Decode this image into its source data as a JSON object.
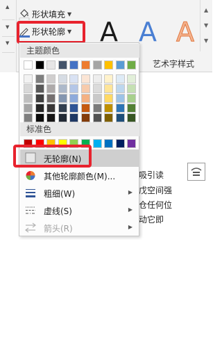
{
  "ribbon": {
    "shape_fill_label": "形状填充",
    "shape_outline_label": "形状轮廓",
    "wordart_letter": "A",
    "wordart_styles_label": "艺术字样式",
    "wordart_colors": [
      "#1a1a1a",
      "#4a7fd3",
      "#f0a070"
    ]
  },
  "menu": {
    "theme_colors_header": "主题颜色",
    "standard_colors_header": "标准色",
    "theme_colors_top": [
      "#ffffff",
      "#000000",
      "#e7e6e6",
      "#44546a",
      "#4472c4",
      "#ed7d31",
      "#a5a5a5",
      "#ffc000",
      "#5b9bd5",
      "#70ad47"
    ],
    "theme_colors_shades": [
      [
        "#f2f2f2",
        "#7f7f7f",
        "#d0cece",
        "#d6dce4",
        "#d9e2f3",
        "#fbe5d5",
        "#ededed",
        "#fff2cc",
        "#deebf6",
        "#e2efd9"
      ],
      [
        "#d8d8d8",
        "#595959",
        "#aeaaaa",
        "#adb9ca",
        "#b4c6e7",
        "#f7cbac",
        "#dbdbdb",
        "#fee599",
        "#bdd7ee",
        "#c5e0b3"
      ],
      [
        "#bfbfbf",
        "#3f3f3f",
        "#757070",
        "#8496b0",
        "#8eaadb",
        "#f4b183",
        "#c9c9c9",
        "#ffd965",
        "#9dc3e6",
        "#a8d08d"
      ],
      [
        "#a5a5a5",
        "#262626",
        "#3a3838",
        "#323f4f",
        "#2f5496",
        "#c55a11",
        "#7b7b7b",
        "#bf9000",
        "#2e75b5",
        "#538135"
      ],
      [
        "#7f7f7f",
        "#0c0c0c",
        "#171616",
        "#222a35",
        "#1f3864",
        "#833c0b",
        "#525252",
        "#7f6000",
        "#1e4e79",
        "#375623"
      ]
    ],
    "standard_colors": [
      "#c00000",
      "#ff0000",
      "#ffc000",
      "#ffff00",
      "#92d050",
      "#00b050",
      "#00b0f0",
      "#0070c0",
      "#002060",
      "#7030a0"
    ],
    "no_outline_label": "无轮廓(N)",
    "more_colors_label": "其他轮廓颜色(M)...",
    "weight_label": "粗细(W)",
    "dashes_label": "虚线(S)",
    "arrows_label": "箭头(R)"
  },
  "document": {
    "lines": [
      "吸引读",
      "戊空间强",
      "仓任何位",
      "动它即"
    ]
  }
}
